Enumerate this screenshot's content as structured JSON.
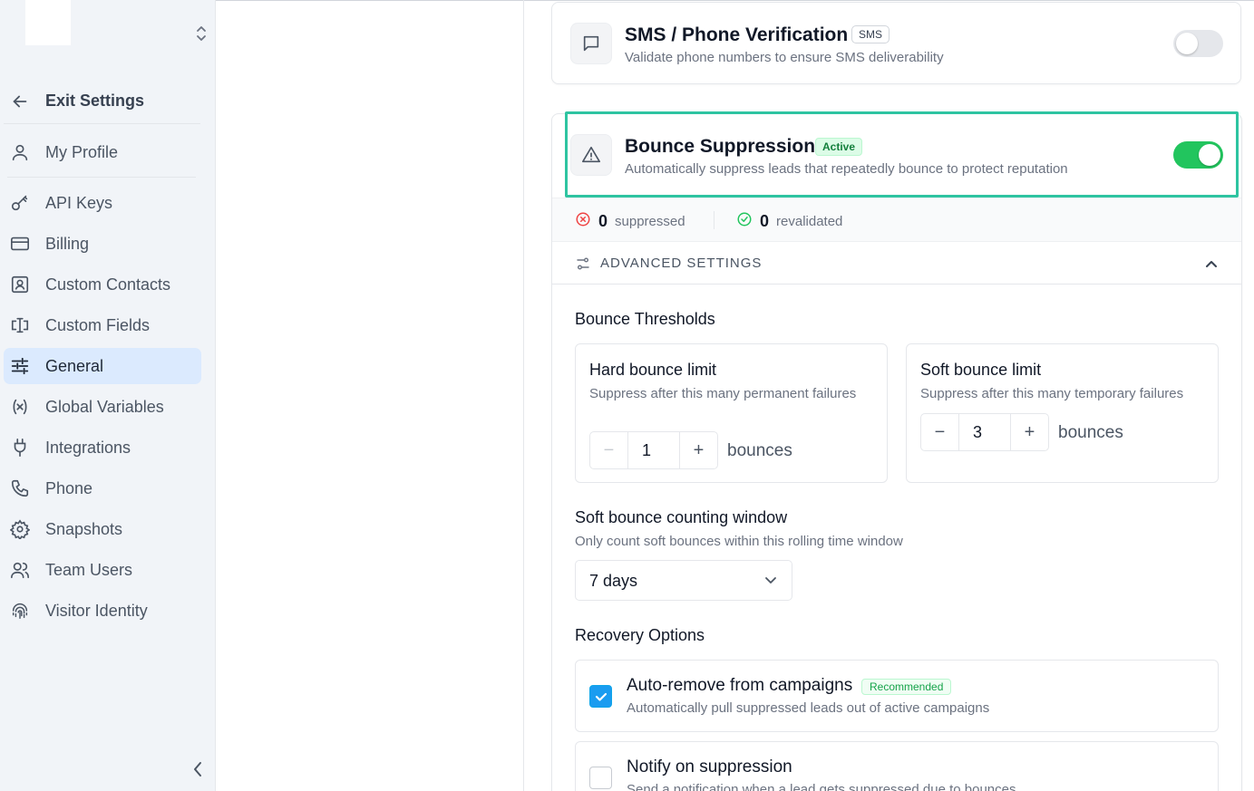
{
  "sidebar": {
    "exit_label": "Exit Settings",
    "items": [
      {
        "label": "My Profile",
        "icon": "user-icon"
      },
      {
        "label": "API Keys",
        "icon": "key-icon"
      },
      {
        "label": "Billing",
        "icon": "credit-card-icon"
      },
      {
        "label": "Custom Contacts",
        "icon": "contact-card-icon"
      },
      {
        "label": "Custom Fields",
        "icon": "text-cursor-icon"
      },
      {
        "label": "General",
        "icon": "sliders-icon",
        "active": true
      },
      {
        "label": "Global Variables",
        "icon": "variable-icon"
      },
      {
        "label": "Integrations",
        "icon": "plug-icon"
      },
      {
        "label": "Phone",
        "icon": "phone-icon"
      },
      {
        "label": "Snapshots",
        "icon": "gear-icon"
      },
      {
        "label": "Team Users",
        "icon": "users-icon"
      },
      {
        "label": "Visitor Identity",
        "icon": "fingerprint-icon"
      }
    ]
  },
  "sms": {
    "title": "SMS / Phone Verification",
    "tag": "SMS",
    "description": "Validate phone numbers to ensure SMS deliverability",
    "enabled": false
  },
  "bounce": {
    "title": "Bounce Suppression",
    "badge": "Active",
    "description": "Automatically suppress leads that repeatedly bounce to protect reputation",
    "enabled": true,
    "stats": {
      "suppressed_count": "0",
      "suppressed_label": "suppressed",
      "revalidated_count": "0",
      "revalidated_label": "revalidated"
    },
    "advanced_label": "ADVANCED SETTINGS",
    "thresholds_title": "Bounce Thresholds",
    "hard": {
      "title": "Hard bounce limit",
      "description": "Suppress after this many permanent failures",
      "value": "1",
      "unit": "bounces"
    },
    "soft": {
      "title": "Soft bounce limit",
      "description": "Suppress after this many temporary failures",
      "value": "3",
      "unit": "bounces"
    },
    "window": {
      "title": "Soft bounce counting window",
      "description": "Only count soft bounces within this rolling time window",
      "selected": "7 days"
    },
    "recovery": {
      "title": "Recovery Options",
      "options": [
        {
          "title": "Auto-remove from campaigns",
          "badge": "Recommended",
          "description": "Automatically pull suppressed leads out of active campaigns",
          "checked": true
        },
        {
          "title": "Notify on suppression",
          "description": "Send a notification when a lead gets suppressed due to bounces",
          "checked": false
        }
      ]
    }
  },
  "colors": {
    "accent": "#22c55e",
    "highlight": "#2ec4a1",
    "checkbox": "#1a9cf0",
    "active_nav": "#dbeafe"
  }
}
